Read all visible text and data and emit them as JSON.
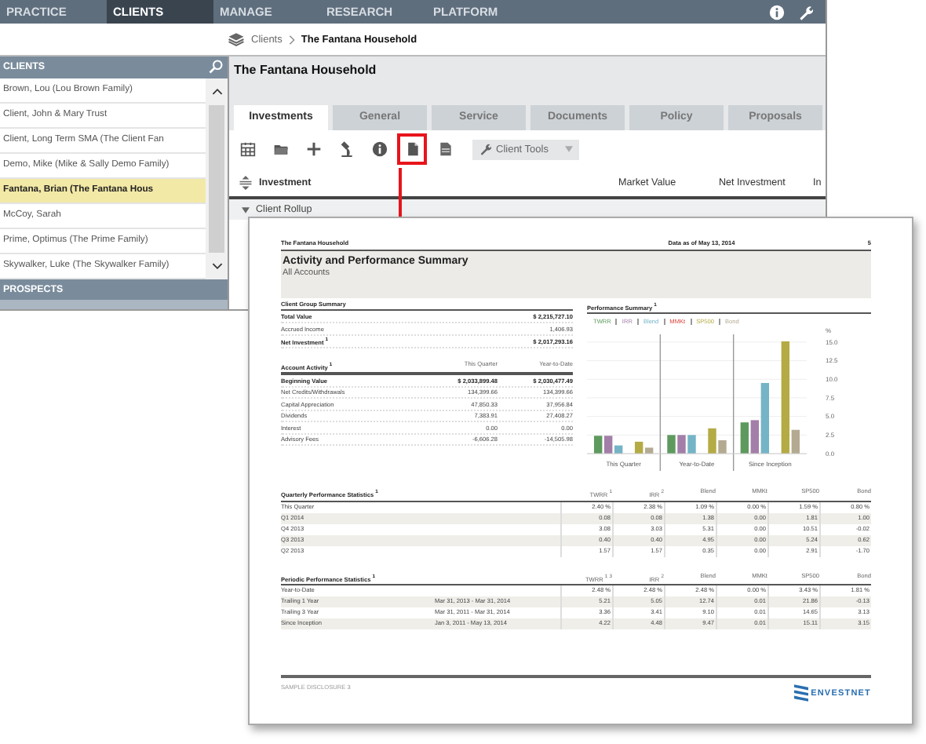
{
  "top_nav": {
    "items": [
      {
        "label": "PRACTICE",
        "selected": false
      },
      {
        "label": "CLIENTS",
        "selected": true
      },
      {
        "label": "MANAGE",
        "selected": false
      },
      {
        "label": "RESEARCH",
        "selected": false
      },
      {
        "label": "PLATFORM",
        "selected": false
      }
    ]
  },
  "breadcrumb": [
    "Clients",
    "The Fantana Household"
  ],
  "sidebar": {
    "header": "CLIENTS",
    "clients": [
      {
        "label": "Brown, Lou (Lou Brown Family)",
        "selected": false
      },
      {
        "label": "Client, John & Mary Trust",
        "selected": false
      },
      {
        "label": "Client, Long Term SMA (The Client Fan",
        "selected": false
      },
      {
        "label": "Demo, Mike (Mike & Sally Demo Family)",
        "selected": false
      },
      {
        "label": "Fantana, Brian (The Fantana Hous",
        "selected": true
      },
      {
        "label": "McCoy, Sarah",
        "selected": false
      },
      {
        "label": "Prime, Optimus (The Prime Family)",
        "selected": false
      },
      {
        "label": "Skywalker, Luke (The Skywalker Family)",
        "selected": false
      }
    ],
    "prospects_header": "PROSPECTS"
  },
  "main": {
    "title": "The Fantana Household",
    "tabs": [
      {
        "label": "Investments",
        "selected": true
      },
      {
        "label": "General",
        "selected": false
      },
      {
        "label": "Service",
        "selected": false
      },
      {
        "label": "Documents",
        "selected": false
      },
      {
        "label": "Policy",
        "selected": false
      },
      {
        "label": "Proposals",
        "selected": false
      }
    ],
    "toolbar": {
      "buttons": [
        {
          "kind": "calendar",
          "highlighted": false
        },
        {
          "kind": "folder",
          "highlighted": false
        },
        {
          "kind": "plus",
          "highlighted": false
        },
        {
          "kind": "microscope",
          "highlighted": false
        },
        {
          "kind": "info",
          "highlighted": false
        },
        {
          "kind": "document",
          "highlighted": true
        },
        {
          "kind": "sheet",
          "highlighted": false
        }
      ],
      "client_tools": "Client Tools"
    },
    "table": {
      "columns": [
        "Investment",
        "Market Value",
        "Net Investment",
        "In"
      ],
      "rows": [
        {
          "label": "Client Rollup",
          "expanded": true
        }
      ]
    }
  },
  "report": {
    "header_left": "The Fantana Household",
    "header_center": "Data as of May 13, 2014",
    "page": "5",
    "title": "Activity and Performance Summary",
    "subtitle": "All Accounts",
    "client_group": {
      "title": "Client Group Summary",
      "rows": [
        {
          "label": "Total Value",
          "value": "$ 2,215,727.10",
          "emphasis": true
        },
        {
          "label": "Accrued Income",
          "value": "1,406.93",
          "emphasis": false
        },
        {
          "label": "Net Investment $^{1}$",
          "value": "$ 2,017,293.16",
          "emphasis": true
        }
      ]
    },
    "account_activity": {
      "title": "Account Activity $^{1}$",
      "columns": [
        "This Quarter",
        "Year-to-Date"
      ],
      "rows": [
        {
          "label": "Beginning Value",
          "values": [
            "$ 2,033,899.48",
            "$ 2,030,477.49"
          ],
          "emphasis": true
        },
        {
          "label": "Net Credits/Withdrawals",
          "values": [
            "134,399.66",
            "134,399.66"
          ],
          "emphasis": false
        },
        {
          "label": "Capital Appreciation",
          "values": [
            "47,850.33",
            "37,956.84"
          ],
          "emphasis": false
        },
        {
          "label": "Dividends",
          "values": [
            "7,383.91",
            "27,408.27"
          ],
          "emphasis": false
        },
        {
          "label": "Interest",
          "values": [
            "0.00",
            "0.00"
          ],
          "emphasis": false
        },
        {
          "label": "Advisory Fees",
          "values": [
            "-6,606.28",
            "-14,505.98"
          ],
          "emphasis": false
        }
      ]
    },
    "performance": {
      "title": "Performance Summary $^{1}$",
      "chart_data": {
        "type": "bar",
        "ylabel": "%",
        "categories": [
          "This Quarter",
          "Year-to-Date",
          "Since Inception"
        ],
        "series": [
          {
            "name": "TWRR",
            "color": "#5e9a5e",
            "values": [
              2.4,
              2.5,
              4.2
            ]
          },
          {
            "name": "IRR",
            "color": "#a27ea8",
            "values": [
              2.4,
              2.5,
              4.5
            ]
          },
          {
            "name": "Blend",
            "color": "#74b4c6",
            "values": [
              1.1,
              2.5,
              9.5
            ]
          },
          {
            "name": "MMKt",
            "color": "#d9443c",
            "values": [
              0,
              0,
              0
            ]
          },
          {
            "name": "SP500",
            "color": "#b4ab44",
            "values": [
              1.6,
              3.4,
              15.1
            ]
          },
          {
            "name": "Bond",
            "color": "#b4aa92",
            "values": [
              0.8,
              1.8,
              3.2
            ]
          }
        ],
        "ylim": [
          0,
          15.2
        ],
        "grid": true,
        "yticks": [
          {
            "value": 0,
            "label": "0.0"
          },
          {
            "value": 2.5,
            "label": "2.5"
          },
          {
            "value": 5,
            "label": "5.0"
          },
          {
            "value": 7.5,
            "label": "7.5"
          },
          {
            "value": 10,
            "label": "10.0"
          },
          {
            "value": 12.5,
            "label": "12.5"
          },
          {
            "value": 15,
            "label": "15.0"
          }
        ]
      }
    },
    "quarterly": {
      "title": "Quarterly Performance Statistics $^{1}$",
      "columns": [
        "TWRR $^{1}$",
        "IRR $^{2}$",
        "Blend",
        "MMKt",
        "SP500",
        "Bond"
      ],
      "rows": [
        {
          "label": "This Quarter",
          "values": [
            "2.40 %",
            "2.38 %",
            "1.09 %",
            "0.00 %",
            "1.59 %",
            "0.80 %"
          ]
        },
        {
          "label": "Q1 2014",
          "values": [
            "0.08",
            "0.08",
            "1.38",
            "0.00",
            "1.81",
            "1.00"
          ]
        },
        {
          "label": "Q4 2013",
          "values": [
            "3.08",
            "3.03",
            "5.31",
            "0.00",
            "10.51",
            "-0.02"
          ]
        },
        {
          "label": "Q3 2013",
          "values": [
            "0.40",
            "0.40",
            "4.95",
            "0.00",
            "5.24",
            "0.62"
          ]
        },
        {
          "label": "Q2 2013",
          "values": [
            "1.57",
            "1.57",
            "0.35",
            "0.00",
            "2.91",
            "-1.70"
          ]
        }
      ]
    },
    "periodic": {
      "title": "Periodic Performance Statistics $^{1}$",
      "columns": [
        "TWRR $^{1}$ $^{3}$",
        "IRR $^{2}$",
        "Blend",
        "MMKt",
        "SP500",
        "Bond"
      ],
      "rows": [
        {
          "label": "Year-to-Date",
          "period": "",
          "values": [
            "2.48 %",
            "2.48 %",
            "2.48 %",
            "0.00 %",
            "3.43 %",
            "1.81 %"
          ]
        },
        {
          "label": "Trailing 1 Year",
          "period": "Mar 31, 2013 - Mar 31, 2014",
          "values": [
            "5.21",
            "5.05",
            "12.74",
            "0.01",
            "21.86",
            "-0.13"
          ]
        },
        {
          "label": "Trailing 3 Year",
          "period": "Mar 31, 2011 - Mar 31, 2014",
          "values": [
            "3.36",
            "3.41",
            "9.10",
            "0.01",
            "14.65",
            "3.13"
          ]
        },
        {
          "label": "Since Inception",
          "period": "Jan 3, 2011 - May 13, 2014",
          "values": [
            "4.22",
            "4.48",
            "9.47",
            "0.01",
            "15.11",
            "3.15"
          ]
        }
      ]
    },
    "footer": {
      "disclosure": "SAMPLE DISCLOSURE 3",
      "logo": "ENVESTNET"
    }
  }
}
